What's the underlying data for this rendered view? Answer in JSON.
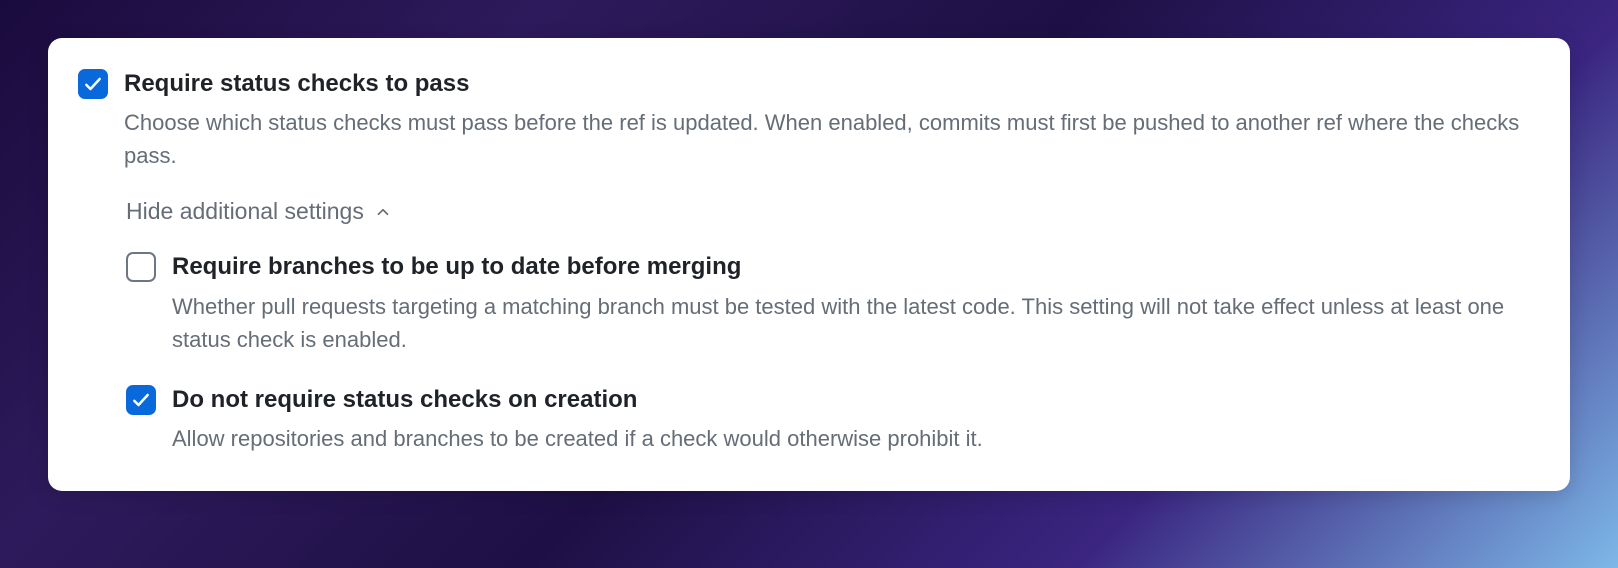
{
  "settings": {
    "require_status_checks": {
      "title": "Require status checks to pass",
      "description": "Choose which status checks must pass before the ref is updated. When enabled, commits must first be pushed to another ref where the checks pass.",
      "checked": true
    },
    "toggle_label": "Hide additional settings",
    "require_up_to_date": {
      "title": "Require branches to be up to date before merging",
      "description": "Whether pull requests targeting a matching branch must be tested with the latest code. This setting will not take effect unless at least one status check is enabled.",
      "checked": false
    },
    "no_require_on_creation": {
      "title": "Do not require status checks on creation",
      "description": "Allow repositories and branches to be created if a check would otherwise prohibit it.",
      "checked": true
    }
  }
}
